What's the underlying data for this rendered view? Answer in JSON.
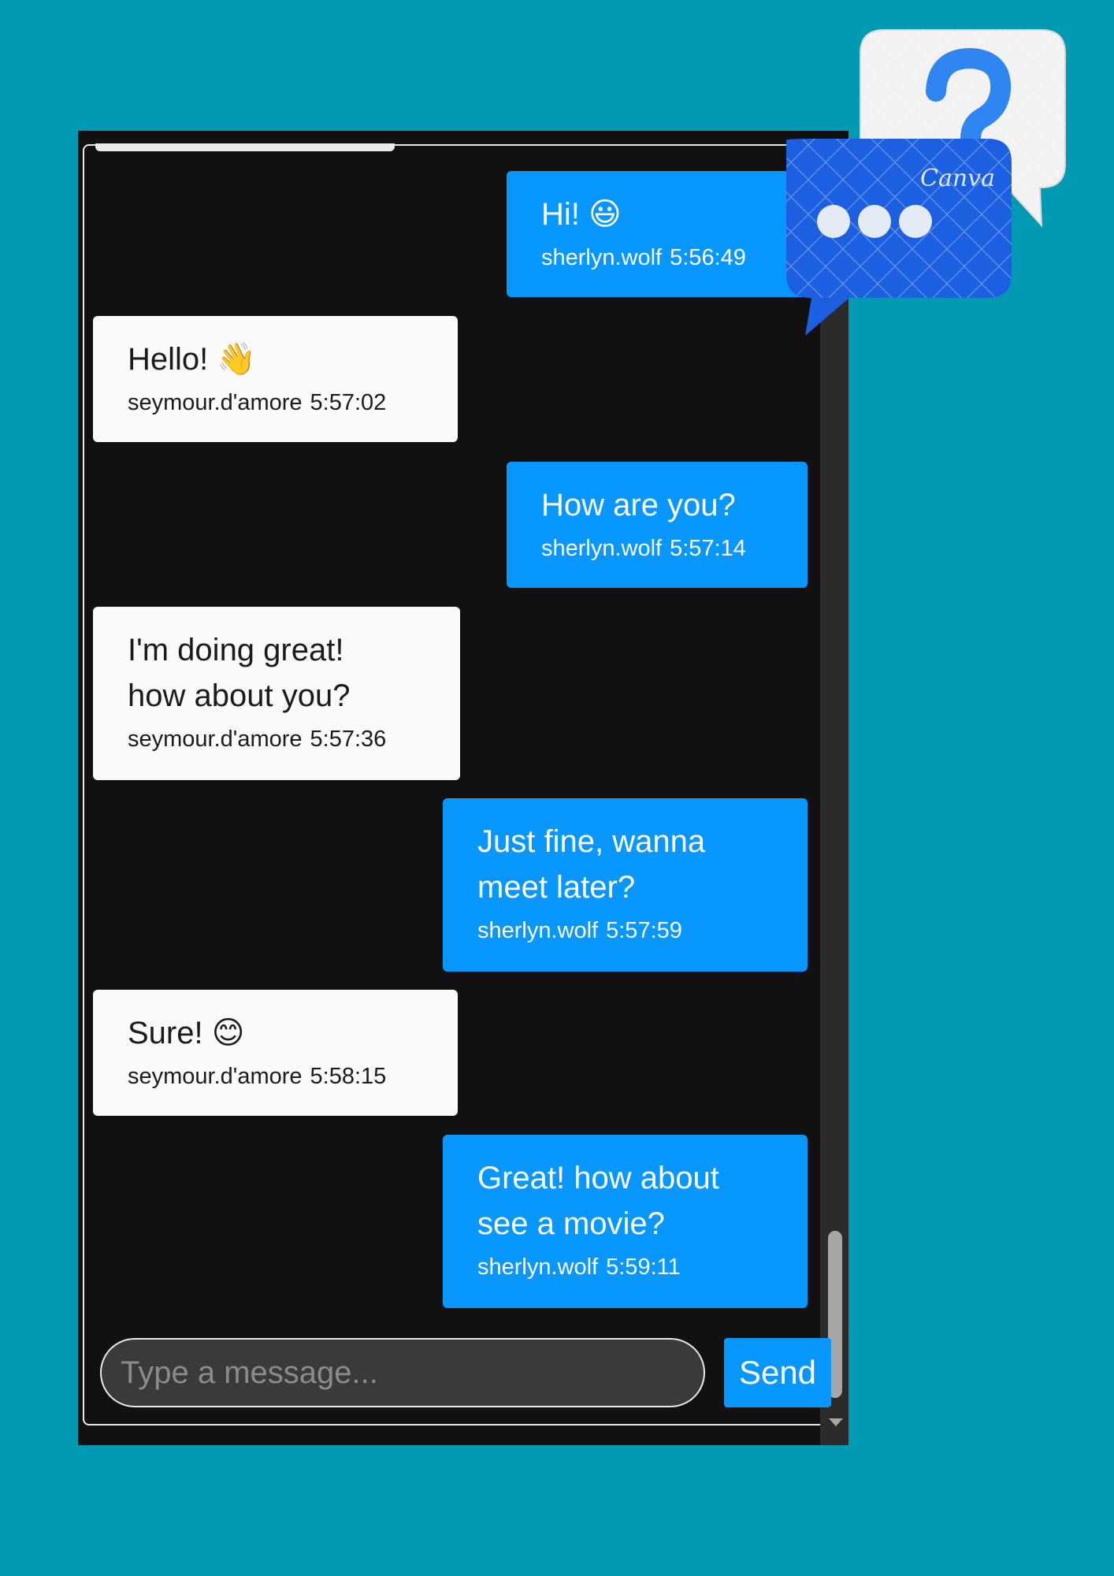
{
  "theme": {
    "page_background": "#0199b3",
    "window_background": "#111111",
    "outgoing_bubble": "#0797ff",
    "incoming_bubble": "#fafafa",
    "accent": "#0797ff"
  },
  "messages": [
    {
      "direction": "outgoing",
      "text": "Hi! 😃",
      "sender": "sherlyn.wolf",
      "time": "5:56:49"
    },
    {
      "direction": "incoming",
      "text": "Hello! 👋",
      "sender": "seymour.d'amore",
      "time": "5:57:02"
    },
    {
      "direction": "outgoing",
      "text": "How are you?",
      "sender": "sherlyn.wolf",
      "time": "5:57:14"
    },
    {
      "direction": "incoming",
      "text": "I'm doing great!\nhow about you?",
      "sender": "seymour.d'amore",
      "time": "5:57:36"
    },
    {
      "direction": "outgoing",
      "text": "Just fine, wanna\nmeet later?",
      "sender": "sherlyn.wolf",
      "time": "5:57:59"
    },
    {
      "direction": "incoming",
      "text": "Sure! 😊",
      "sender": "seymour.d'amore",
      "time": "5:58:15"
    },
    {
      "direction": "outgoing",
      "text": "Great! how about\nsee a movie?",
      "sender": "sherlyn.wolf",
      "time": "5:59:11"
    }
  ],
  "composer": {
    "placeholder": "Type a message...",
    "value": "",
    "send_label": "Send"
  },
  "scrollbar": {
    "position_fraction": 0.98
  },
  "sticker": {
    "icons": [
      "question-mark-icon",
      "typing-dots-icon"
    ],
    "watermark": "Canva",
    "colors": {
      "question_bubble": "#f2f2f2",
      "question_mark": "#2f86f0",
      "dots_bubble": "#1c5fe0",
      "dots": "#e4ebf7"
    }
  }
}
